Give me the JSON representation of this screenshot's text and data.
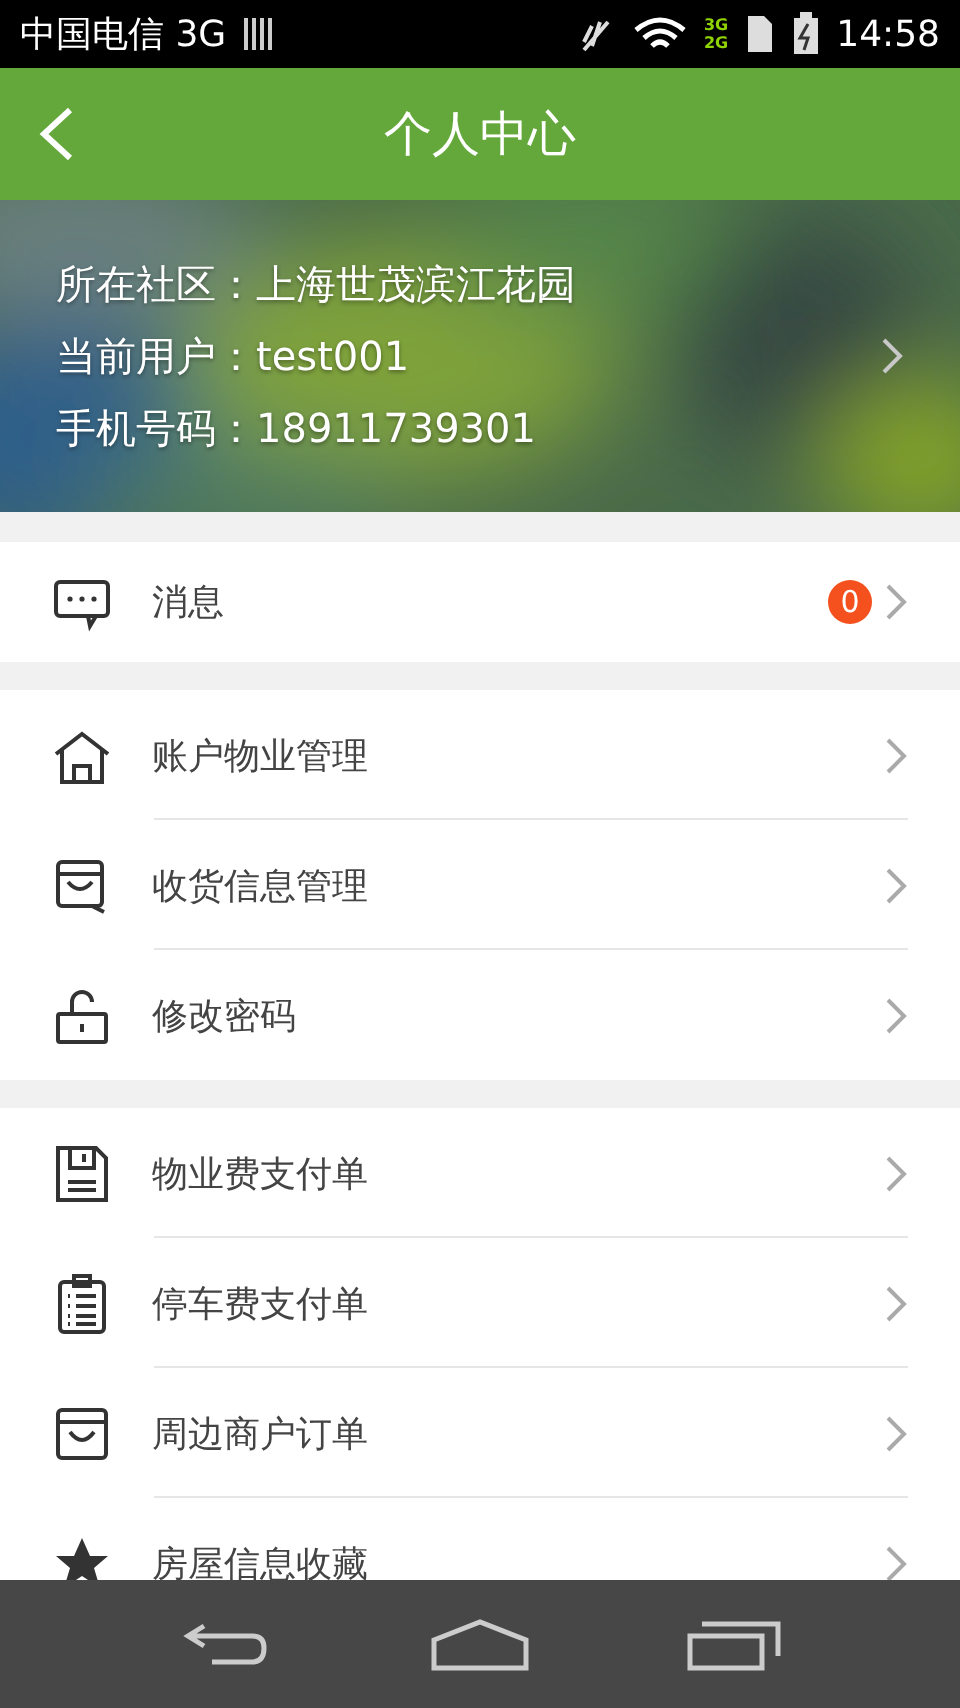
{
  "status_bar": {
    "carrier": "中国电信 3G",
    "network_labels": [
      "3G",
      "2G"
    ],
    "time": "14:58"
  },
  "header": {
    "title": "个人中心"
  },
  "profile": {
    "lines": [
      "所在社区：上海世茂滨江花园",
      "当前用户：test001",
      "手机号码：18911739301"
    ]
  },
  "menu_groups": [
    {
      "items": [
        {
          "kind": "message",
          "label": "消息",
          "badge": "0"
        }
      ]
    },
    {
      "items": [
        {
          "kind": "house",
          "label": "账户物业管理"
        },
        {
          "kind": "box",
          "label": "收货信息管理"
        },
        {
          "kind": "lock",
          "label": "修改密码"
        }
      ]
    },
    {
      "items": [
        {
          "kind": "disk",
          "label": "物业费支付单"
        },
        {
          "kind": "clipboard",
          "label": "停车费支付单"
        },
        {
          "kind": "bag",
          "label": "周边商户订单"
        },
        {
          "kind": "star",
          "label": "房屋信息收藏"
        }
      ]
    }
  ]
}
